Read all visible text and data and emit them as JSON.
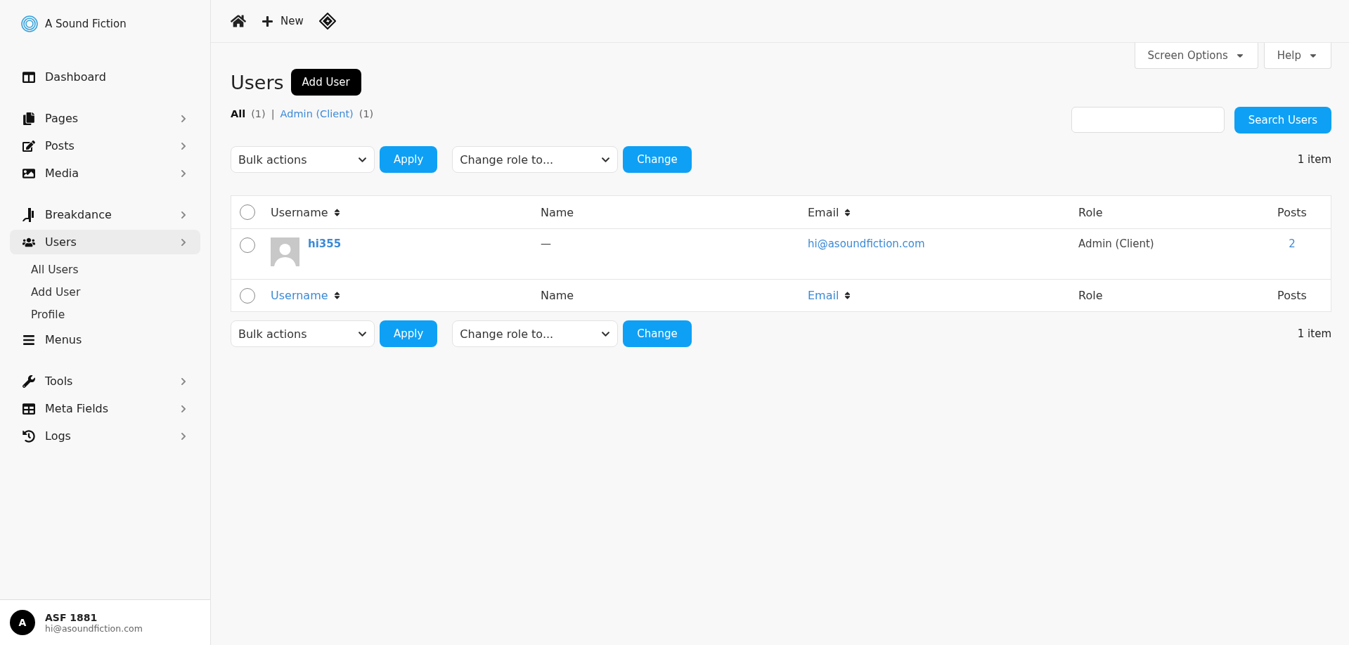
{
  "brand": {
    "name": "A Sound Fiction"
  },
  "sidebar": {
    "groups": [
      {
        "items": [
          {
            "label": "Dashboard",
            "has_submenu": false,
            "selected": false
          }
        ]
      },
      {
        "items": [
          {
            "label": "Pages",
            "has_submenu": true,
            "selected": false
          },
          {
            "label": "Posts",
            "has_submenu": true,
            "selected": false
          },
          {
            "label": "Media",
            "has_submenu": true,
            "selected": false
          }
        ]
      },
      {
        "items": [
          {
            "label": "Breakdance",
            "has_submenu": true,
            "selected": false
          },
          {
            "label": "Users",
            "has_submenu": true,
            "selected": true,
            "children": [
              {
                "label": "All Users",
                "selected": false
              },
              {
                "label": "Add User",
                "selected": false
              },
              {
                "label": "Profile",
                "selected": false
              }
            ]
          },
          {
            "label": "Menus",
            "has_submenu": false,
            "selected": false
          }
        ]
      },
      {
        "items": [
          {
            "label": "Tools",
            "has_submenu": true,
            "selected": false
          },
          {
            "label": "Meta Fields",
            "has_submenu": true,
            "selected": false
          },
          {
            "label": "Logs",
            "has_submenu": true,
            "selected": false
          }
        ]
      }
    ]
  },
  "account": {
    "initial": "A",
    "name": "ASF 1881",
    "email": "hi@asoundfiction.com"
  },
  "topbar": {
    "new_label": "New"
  },
  "screen_tabs": [
    "Screen Options",
    "Help"
  ],
  "page": {
    "title": "Users",
    "add_button": "Add User"
  },
  "views": {
    "separator": "|",
    "items": [
      {
        "label": "All",
        "count": "(1)",
        "selected": true
      },
      {
        "label": "Admin (Client)",
        "count": "(1)",
        "selected": false
      }
    ]
  },
  "search": {
    "button": "Search Users"
  },
  "toolbars": [
    {
      "bulk": "Bulk actions",
      "apply": "Apply",
      "role": "Change role to...",
      "change": "Change",
      "count": "1 item"
    },
    {
      "bulk": "Bulk actions",
      "apply": "Apply",
      "role": "Change role to...",
      "change": "Change",
      "count": "1 item"
    }
  ],
  "table": {
    "header": {
      "checked": false,
      "columns": [
        {
          "label": "Username",
          "sortable": true,
          "linked": false
        },
        {
          "label": "Name",
          "sortable": false,
          "linked": false
        },
        {
          "label": "Email",
          "sortable": true,
          "linked": false
        },
        {
          "label": "Role",
          "sortable": false,
          "linked": false
        },
        {
          "label": "Posts",
          "sortable": false,
          "linked": false
        }
      ]
    },
    "rows": [
      {
        "checked": false,
        "username": "hi355",
        "name": "—",
        "email": "hi@asoundfiction.com",
        "role": "Admin (Client)",
        "posts": "2"
      }
    ],
    "footer": {
      "checked": false,
      "columns": [
        {
          "label": "Username",
          "sortable": true,
          "linked": true
        },
        {
          "label": "Name",
          "sortable": false,
          "linked": false
        },
        {
          "label": "Email",
          "sortable": true,
          "linked": true
        },
        {
          "label": "Role",
          "sortable": false,
          "linked": false
        },
        {
          "label": "Posts",
          "sortable": false,
          "linked": false
        }
      ]
    }
  }
}
